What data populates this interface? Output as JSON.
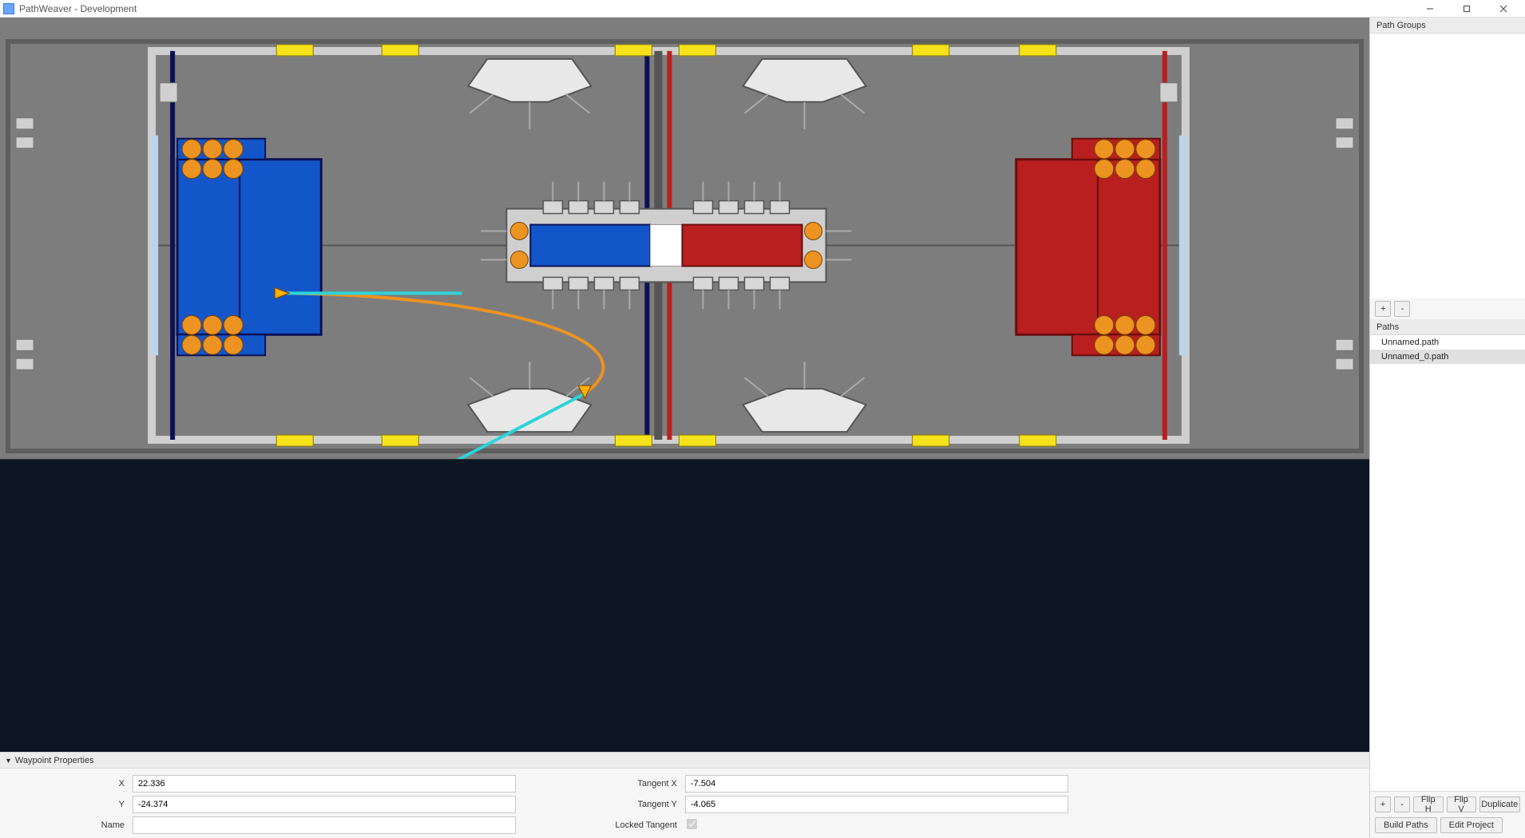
{
  "window": {
    "title": "PathWeaver - Development"
  },
  "right": {
    "groups_header": "Path Groups",
    "paths_header": "Paths",
    "add_label": "+",
    "remove_label": "-",
    "paths": [
      {
        "label": "Unnamed.path",
        "selected": false
      },
      {
        "label": "Unnamed_0.path",
        "selected": true
      }
    ],
    "flip_h": "Flip H",
    "flip_v": "Flip V",
    "duplicate": "Duplicate",
    "build": "Build Paths",
    "edit": "Edit Project"
  },
  "props": {
    "header": "Waypoint Properties",
    "x_label": "X",
    "x_value": "22.336",
    "y_label": "Y",
    "y_value": "-24.374",
    "name_label": "Name",
    "name_value": "",
    "tx_label": "Tangent X",
    "tx_value": "-7.504",
    "ty_label": "Tangent Y",
    "ty_value": "-4.065",
    "locked_label": "Locked Tangent",
    "locked": true
  },
  "field_colors": {
    "blue": "#1356c9",
    "red": "#b91f1f",
    "navy": "#0b1156",
    "gray": "#7d7d7d",
    "yellow": "#f6e21b",
    "orange": "#ec9321",
    "cyan": "#2cd4da",
    "pathOrange": "#ec9321"
  }
}
